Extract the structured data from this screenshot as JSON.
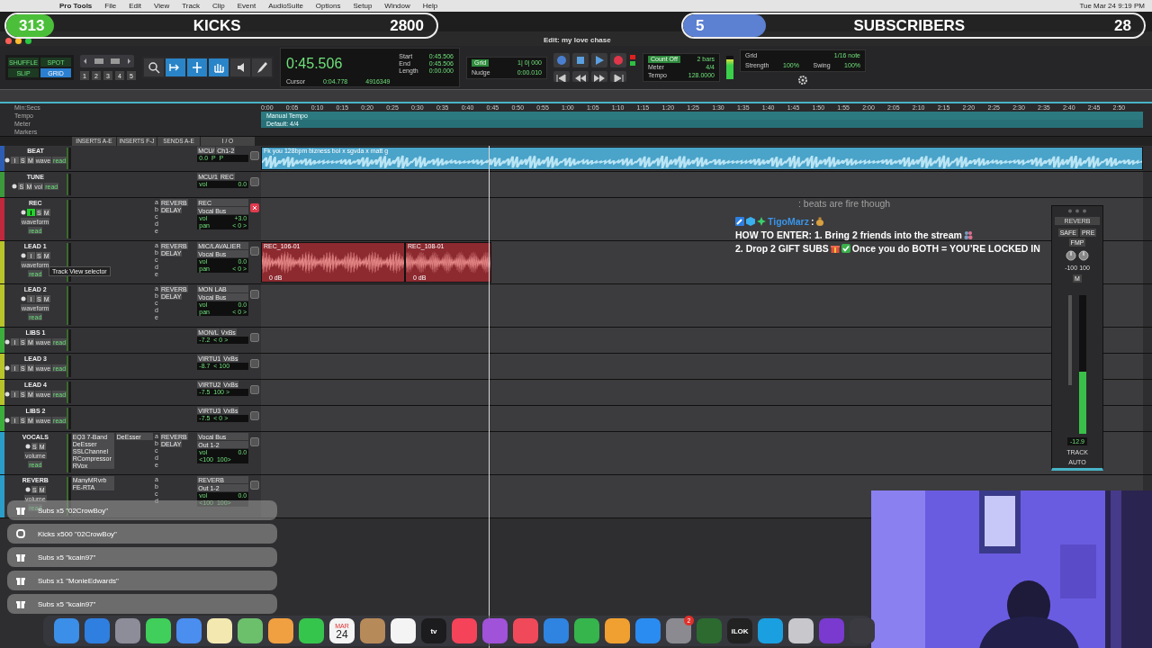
{
  "menu_bar": {
    "items": [
      "Pro Tools",
      "File",
      "Edit",
      "View",
      "Track",
      "Clip",
      "Event",
      "AudioSuite",
      "Options",
      "Setup",
      "Window",
      "Help"
    ],
    "clock": "Tue Mar 24  9:19 PM"
  },
  "stream_bars": [
    {
      "count": "313",
      "label": "KICKS",
      "goal": "2800",
      "level": 0.11,
      "color": "#4cbf3a"
    },
    {
      "count": "5",
      "label": "SUBSCRIBERS",
      "goal": "28",
      "level": 0.18,
      "color": "#5c80d2"
    }
  ],
  "window": {
    "title": "Edit: my love chase"
  },
  "toolbar": {
    "edit_modes": [
      {
        "label": "SHUFFLE",
        "selected": false
      },
      {
        "label": "SPOT",
        "selected": false
      },
      {
        "label": "SLIP",
        "selected": false
      },
      {
        "label": "GRID",
        "selected": true
      }
    ],
    "zoom_presets": [
      "1",
      "2",
      "3",
      "4",
      "5"
    ],
    "tools": [
      {
        "kind": "zoom",
        "selected": false
      },
      {
        "kind": "trim",
        "selected": true
      },
      {
        "kind": "select",
        "selected": true
      },
      {
        "kind": "grab",
        "selected": true
      },
      {
        "kind": "scrub",
        "selected": false
      },
      {
        "kind": "pencil",
        "selected": false
      }
    ],
    "counter": "0:45.506",
    "selection": [
      {
        "label": "Start",
        "value": "0:45.506"
      },
      {
        "label": "End",
        "value": "0:45.506"
      },
      {
        "label": "Length",
        "value": "0:00.000"
      }
    ],
    "cursor": {
      "label": "Cursor",
      "value": "0:04.778",
      "samples": "4916349"
    },
    "grid": {
      "label": "Grid",
      "value": "1| 0| 000"
    },
    "nudge": {
      "label": "Nudge",
      "value": "0:00.010"
    },
    "tempo": [
      {
        "label": "Count Off",
        "value": "2 bars"
      },
      {
        "label": "Meter",
        "value": "4/4"
      },
      {
        "label": "Tempo",
        "value": "128.0000"
      }
    ],
    "midi_grid": {
      "label": "Grid",
      "value": "1/16 note"
    },
    "strength": {
      "label": "Strength",
      "value": "100%"
    },
    "swing": {
      "label": "Swing",
      "value": "100%"
    },
    "meter": {
      "level": 0.85
    }
  },
  "rulers": {
    "labels": [
      "Min:Secs",
      "Tempo",
      "Meter",
      "Markers"
    ],
    "times": [
      "0:00",
      "0:05",
      "0:10",
      "0:15",
      "0:20",
      "0:25",
      "0:30",
      "0:35",
      "0:40",
      "0:45",
      "0:50",
      "0:55",
      "1:00",
      "1:05",
      "1:10",
      "1:15",
      "1:20",
      "1:25",
      "1:30",
      "1:35",
      "1:40",
      "1:45",
      "1:50",
      "1:55",
      "2:00",
      "2:05",
      "2:10",
      "2:15",
      "2:20",
      "2:25",
      "2:30",
      "2:35",
      "2:40",
      "2:45",
      "2:50"
    ],
    "tempo": "Manual Tempo",
    "meter": "Default: 4/4"
  },
  "columns": [
    "INSERTS A-E",
    "INSERTS F-J",
    "SENDS A-E",
    "I / O"
  ],
  "tracks": [
    {
      "name": "BEAT",
      "color": "#2c5db3",
      "kind": "small",
      "buttons": [
        "I",
        "S",
        "M"
      ],
      "input_on": false,
      "record_enabled": false,
      "view": "wave",
      "automation": "read",
      "io": [
        "MCU/",
        "Ch1-2"
      ],
      "readouts": [
        {
          "value": "0.0  P  P"
        }
      ],
      "clips": [
        {
          "kind": "full",
          "name": "Fk you 128bpm bizness boi x sgvda x matt g",
          "color": "#4aa3c9"
        }
      ]
    },
    {
      "name": "TUNE",
      "color": "#3c9a3c",
      "kind": "small",
      "buttons": [
        "S",
        "M"
      ],
      "record_enabled": false,
      "view": "vol",
      "automation": "read",
      "io": [
        "MCU/1",
        "REC"
      ],
      "readouts": [
        {
          "label": "vol",
          "value": "0.0"
        }
      ]
    },
    {
      "name": "REC",
      "color": "#c0283c",
      "kind": "large",
      "buttons": [
        "I",
        "S",
        "M"
      ],
      "input_on": true,
      "record_enabled": true,
      "view": "waveform",
      "automation": "read",
      "sends": [
        {
          "slot": "a",
          "name": "REVERB"
        },
        {
          "slot": "b",
          "name": "DELAY"
        },
        {
          "slot": "c"
        },
        {
          "slot": "d"
        },
        {
          "slot": "e"
        }
      ],
      "io": [
        "REC",
        "Vocal Bus"
      ],
      "readouts": [
        {
          "label": "vol",
          "value": "+3.0"
        },
        {
          "label": "pan",
          "value": "< 0 >"
        }
      ]
    },
    {
      "name": "LEAD 1",
      "color": "#b8c42a",
      "kind": "large",
      "buttons": [
        "I",
        "S",
        "M"
      ],
      "input_on": false,
      "record_enabled": false,
      "view": "waveform",
      "automation": "read",
      "sends": [
        {
          "slot": "a",
          "name": "REVERB"
        },
        {
          "slot": "b",
          "name": "DELAY"
        },
        {
          "slot": "c"
        },
        {
          "slot": "d"
        },
        {
          "slot": "e"
        }
      ],
      "io": [
        "MIC/LAVALIER",
        "Vocal Bus"
      ],
      "readouts": [
        {
          "label": "vol",
          "value": "0.0"
        },
        {
          "label": "pan",
          "value": "< 0 >"
        }
      ],
      "clips": [
        {
          "kind": "take",
          "name": "REC_106-01",
          "color": "#8c2a30",
          "gain": "0 dB"
        },
        {
          "kind": "take",
          "name": "REC_108-01",
          "color": "#8c2a30",
          "gain": "0 dB"
        }
      ]
    },
    {
      "name": "LEAD 2",
      "color": "#b8c42a",
      "kind": "large",
      "buttons": [
        "I",
        "S",
        "M"
      ],
      "input_on": false,
      "record_enabled": false,
      "view": "waveform",
      "automation": "read",
      "sends": [
        {
          "slot": "a",
          "name": "REVERB"
        },
        {
          "slot": "b",
          "name": "DELAY"
        },
        {
          "slot": "c"
        },
        {
          "slot": "d"
        },
        {
          "slot": "e"
        }
      ],
      "io": [
        "MON LAB",
        "Vocal Bus"
      ],
      "readouts": [
        {
          "label": "vol",
          "value": "0.0"
        },
        {
          "label": "pan",
          "value": "< 0 >"
        }
      ]
    },
    {
      "name": "LIBS 1",
      "color": "#3cae3c",
      "kind": "small",
      "buttons": [
        "I",
        "S",
        "M"
      ],
      "input_on": false,
      "record_enabled": false,
      "view": "wave",
      "automation": "read",
      "io": [
        "MON/L",
        "VxBs"
      ],
      "readouts": [
        {
          "value": "-7.2  < 0 >"
        }
      ]
    },
    {
      "name": "LEAD 3",
      "color": "#b8c42a",
      "kind": "small",
      "buttons": [
        "I",
        "S",
        "M"
      ],
      "input_on": false,
      "record_enabled": false,
      "view": "wave",
      "automation": "read",
      "io": [
        "VIRTU1",
        "VxBs"
      ],
      "readouts": [
        {
          "value": "-8.7  < 100"
        }
      ]
    },
    {
      "name": "LEAD 4",
      "color": "#b8c42a",
      "kind": "small",
      "buttons": [
        "I",
        "S",
        "M"
      ],
      "input_on": false,
      "record_enabled": false,
      "view": "wave",
      "automation": "read",
      "io": [
        "VIRTU2",
        "VxBs"
      ],
      "readouts": [
        {
          "value": "-7.5  100 >"
        }
      ]
    },
    {
      "name": "LIBS 2",
      "color": "#3cae3c",
      "kind": "small",
      "buttons": [
        "I",
        "S",
        "M"
      ],
      "input_on": false,
      "record_enabled": false,
      "view": "wave",
      "automation": "read",
      "io": [
        "VIRTU3",
        "VxBs"
      ],
      "readouts": [
        {
          "value": "-7.5  < 0 >"
        }
      ]
    },
    {
      "name": "VOCALS",
      "color": "#2a9ec8",
      "kind": "large",
      "buttons": [
        "S",
        "M"
      ],
      "record_enabled": false,
      "view": "volume",
      "automation": "read",
      "inserts_a": [
        "EQ3 7-Band",
        "DeEsser",
        "SSLChannel",
        "RCompressor",
        "RVox"
      ],
      "inserts_b": [
        "DeEsser"
      ],
      "sends": [
        {
          "slot": "a",
          "name": "REVERB"
        },
        {
          "slot": "b",
          "name": "DELAY"
        },
        {
          "slot": "c"
        },
        {
          "slot": "d"
        },
        {
          "slot": "e"
        }
      ],
      "io": [
        "Vocal Bus",
        "Out 1-2"
      ],
      "readouts": [
        {
          "label": "vol",
          "value": "0.0"
        },
        {
          "value": "<100  100>"
        }
      ]
    },
    {
      "name": "REVERB",
      "color": "#2a9ec8",
      "kind": "large",
      "buttons": [
        "S",
        "M"
      ],
      "record_enabled": false,
      "view": "volume",
      "automation": "read",
      "inserts_a": [
        "ManyMRvrb",
        "FE-RTA"
      ],
      "sends": [
        {
          "slot": "a"
        },
        {
          "slot": "b"
        },
        {
          "slot": "c"
        },
        {
          "slot": "d"
        }
      ],
      "io": [
        "REVERB",
        "Out 1-2"
      ],
      "readouts": [
        {
          "label": "vol",
          "value": "0.0"
        },
        {
          "value": "<100  100>"
        }
      ]
    }
  ],
  "tooltip": "Track View selector",
  "chat": [
    {
      "text": ": beats are fire though",
      "faded": true
    },
    {
      "badges": [
        {
          "kind": "tool"
        },
        {
          "kind": "cube"
        },
        {
          "kind": "sparkle"
        }
      ],
      "user": "TigoMarz",
      "faded": false,
      "parts": [
        {
          "kind": "text",
          "text": ": "
        },
        {
          "kind": "bag"
        },
        {
          "kind": "text",
          "text": " HOW TO ENTER: 1. Bring 2 friends into the stream "
        },
        {
          "kind": "people"
        },
        {
          "kind": "text",
          "text": "2. Drop 2 GIFT SUBS "
        },
        {
          "kind": "gift"
        },
        {
          "kind": "check"
        },
        {
          "kind": "text",
          "text": " Once you do BOTH = YOU’RE LOCKED IN"
        }
      ]
    }
  ],
  "floating_strip": {
    "output": "REVERB",
    "buttons": [
      "SAFE",
      "PRE",
      "FMP"
    ],
    "pan": [
      "-100",
      "100"
    ],
    "mute": "M",
    "level": 0.45,
    "reading": "-12.9",
    "modes": [
      "TRACK",
      "AUTO"
    ]
  },
  "alerts": [
    {
      "kind": "gift",
      "text": "Subs x5 \"02CrowBoy\""
    },
    {
      "kind": "kick",
      "text": "Kicks x500 \"02CrowBoy\""
    },
    {
      "kind": "gift",
      "text": "Subs x5 \"kcain97\""
    },
    {
      "kind": "gift",
      "text": "Subs x1 \"MonieEdwards\""
    },
    {
      "kind": "gift",
      "text": "Subs x5 \"kcain97\""
    }
  ],
  "dock": [
    {
      "color": "#3b8fe8"
    },
    {
      "color": "#2f7fe0"
    },
    {
      "color": "#8d8d99"
    },
    {
      "color": "#3fcf5a"
    },
    {
      "color": "#4a8ef0"
    },
    {
      "color": "#f3e9b0"
    },
    {
      "color": "#6cc06c"
    },
    {
      "color": "#f0a040"
    },
    {
      "color": "#36c54c"
    },
    {
      "color": "#f4f4f4",
      "month": "MAR",
      "day": "24"
    },
    {
      "color": "#b78a5a"
    },
    {
      "color": "#f4f4f4"
    },
    {
      "color": "#1c1c1e",
      "label": "tv"
    },
    {
      "color": "#f5435a"
    },
    {
      "color": "#a052d8"
    },
    {
      "color": "#f04a5a"
    },
    {
      "color": "#2e84e0"
    },
    {
      "color": "#36b54c"
    },
    {
      "color": "#f0a030"
    },
    {
      "color": "#2a8cf0"
    },
    {
      "color": "#8a8a90",
      "badge": "2"
    },
    {
      "color": "#2c6a30"
    },
    {
      "color": "#222222",
      "label": "iLOK"
    },
    {
      "color": "#1a9fe0"
    },
    {
      "color": "#c8c8cc"
    },
    {
      "color": "#7a3ad0"
    },
    {
      "color": "#3a3a40"
    }
  ]
}
